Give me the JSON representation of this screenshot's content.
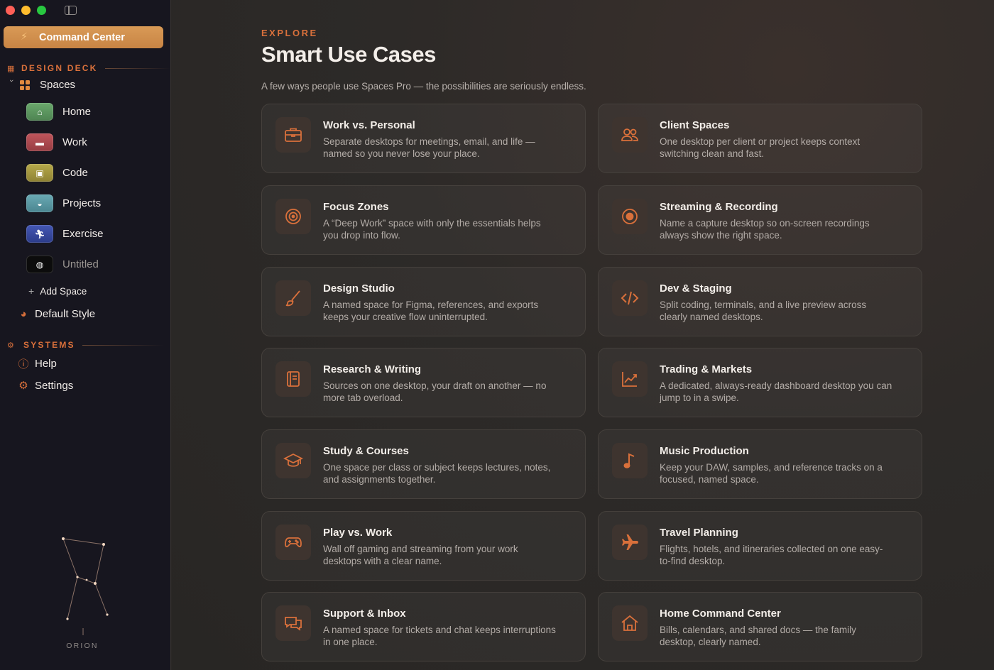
{
  "window": {
    "controls": [
      "close",
      "minimize",
      "zoom"
    ]
  },
  "sidebar": {
    "command_center": "Command Center",
    "design_deck_heading": "DESIGN DECK",
    "spaces_label": "Spaces",
    "spaces": [
      {
        "name": "Home",
        "icon": "house-icon",
        "color": "#5f9a62"
      },
      {
        "name": "Work",
        "icon": "briefcase-icon",
        "color": "#b0484f"
      },
      {
        "name": "Code",
        "icon": "terminal-icon",
        "color": "#a89a3c"
      },
      {
        "name": "Projects",
        "icon": "stack-icon",
        "color": "#5c9aa6"
      },
      {
        "name": "Exercise",
        "icon": "runner-icon",
        "color": "#3a4fa0"
      },
      {
        "name": "Untitled",
        "icon": "globe-icon",
        "color": "#0c0c0c"
      }
    ],
    "add_space": "Add Space",
    "default_style": "Default Style",
    "systems_heading": "SYSTEMS",
    "help": "Help",
    "settings": "Settings",
    "constellation_label": "ORION"
  },
  "main": {
    "eyebrow": "EXPLORE",
    "title": "Smart Use Cases",
    "subtitle": "A few ways people use Spaces Pro — the possibilities are seriously endless.",
    "cards": [
      {
        "title": "Work vs. Personal",
        "desc": "Separate desktops for meetings, email, and life — named so you never lose your place.",
        "icon": "briefcase-icon"
      },
      {
        "title": "Client Spaces",
        "desc": "One desktop per client or project keeps context switching clean and fast.",
        "icon": "people-icon"
      },
      {
        "title": "Focus Zones",
        "desc": "A “Deep Work” space with only the essentials helps you drop into flow.",
        "icon": "target-icon"
      },
      {
        "title": "Streaming & Recording",
        "desc": "Name a capture desktop so on-screen recordings always show the right space.",
        "icon": "record-icon"
      },
      {
        "title": "Design Studio",
        "desc": "A named space for Figma, references, and exports keeps your creative flow uninterrupted.",
        "icon": "brush-icon"
      },
      {
        "title": "Dev & Staging",
        "desc": "Split coding, terminals, and a live preview across clearly named desktops.",
        "icon": "code-icon"
      },
      {
        "title": "Research & Writing",
        "desc": "Sources on one desktop, your draft on another — no more tab overload.",
        "icon": "book-icon"
      },
      {
        "title": "Trading & Markets",
        "desc": "A dedicated, always-ready dashboard desktop you can jump to in a swipe.",
        "icon": "chart-icon"
      },
      {
        "title": "Study & Courses",
        "desc": "One space per class or subject keeps lectures, notes, and assignments together.",
        "icon": "graduation-cap-icon"
      },
      {
        "title": "Music Production",
        "desc": "Keep your DAW, samples, and reference tracks on a focused, named space.",
        "icon": "music-note-icon"
      },
      {
        "title": "Play vs. Work",
        "desc": "Wall off gaming and streaming from your work desktops with a clear name.",
        "icon": "gamepad-icon"
      },
      {
        "title": "Travel Planning",
        "desc": "Flights, hotels, and itineraries collected on one easy-to-find desktop.",
        "icon": "airplane-icon"
      },
      {
        "title": "Support & Inbox",
        "desc": "A named space for tickets and chat keeps interruptions in one place.",
        "icon": "chat-bubbles-icon"
      },
      {
        "title": "Home Command Center",
        "desc": "Bills, calendars, and shared docs — the family desktop, clearly named.",
        "icon": "house-icon"
      }
    ]
  },
  "colors": {
    "accent": "#d9703b",
    "sidebar_bg": "#17161f",
    "main_bg": "#2b2826",
    "command_center_bg": "#d99a56"
  }
}
